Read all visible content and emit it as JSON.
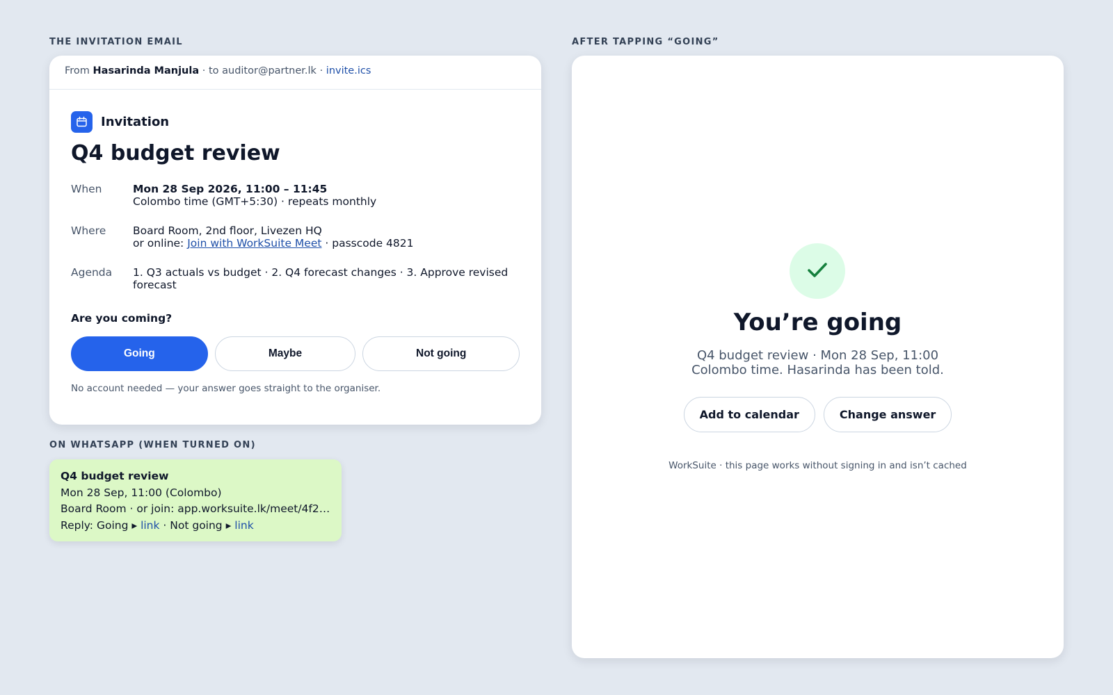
{
  "sections": {
    "email_label": "THE INVITATION EMAIL",
    "after_label": "AFTER TAPPING “GOING”",
    "whatsapp_label": "ON WHATSAPP (WHEN TURNED ON)"
  },
  "email": {
    "from_prefix": "From",
    "sender": "Hasarinda Manjula",
    "recipient_text": "· to auditor@partner.lk ·",
    "attachment": "invite.ics",
    "tag_icon": "calendar-icon",
    "tag_label": "Invitation",
    "title": "Q4 budget review",
    "when_label": "When",
    "when_main": "Mon 28 Sep 2026, 11:00 – 11:45",
    "when_sub": "Colombo time (GMT+5:30) · repeats monthly",
    "where_label": "Where",
    "where_main": "Board Room, 2nd floor, Livezen HQ",
    "where_online_prefix": "or online:",
    "where_link": "Join with WorkSuite Meet",
    "where_passcode": "· passcode 4821",
    "agenda_label": "Agenda",
    "agenda_text": "1. Q3 actuals vs budget · 2. Q4 forecast changes · 3. Approve revised forecast",
    "question": "Are you coming?",
    "buttons": {
      "going": "Going",
      "maybe": "Maybe",
      "not_going": "Not going"
    },
    "fine_print": "No account needed — your answer goes straight to the organiser."
  },
  "whatsapp": {
    "title": "Q4 budget review",
    "line1": "Mon 28 Sep, 11:00 (Colombo)",
    "line2": "Board Room · or join: app.worksuite.lk/meet/4f2…",
    "reply_prefix": "Reply: Going ▸",
    "reply_link1": "link",
    "reply_mid": "· Not going ▸",
    "reply_link2": "link"
  },
  "confirmation": {
    "icon": "check-icon",
    "title": "You’re going",
    "sub_line1": "Q4 budget review · Mon 28 Sep, 11:00",
    "sub_line2": "Colombo time. Hasarinda has been told.",
    "add_button": "Add to calendar",
    "change_button": "Change answer",
    "footer": "WorkSuite · this page works without signing in and isn’t cached"
  },
  "colors": {
    "background": "#e2e8f0",
    "accent": "#2563eb",
    "link": "#1e4fa8",
    "whatsapp_bubble": "#dcf8c6",
    "success_bg": "#dcfce7",
    "success_fg": "#15803d"
  }
}
